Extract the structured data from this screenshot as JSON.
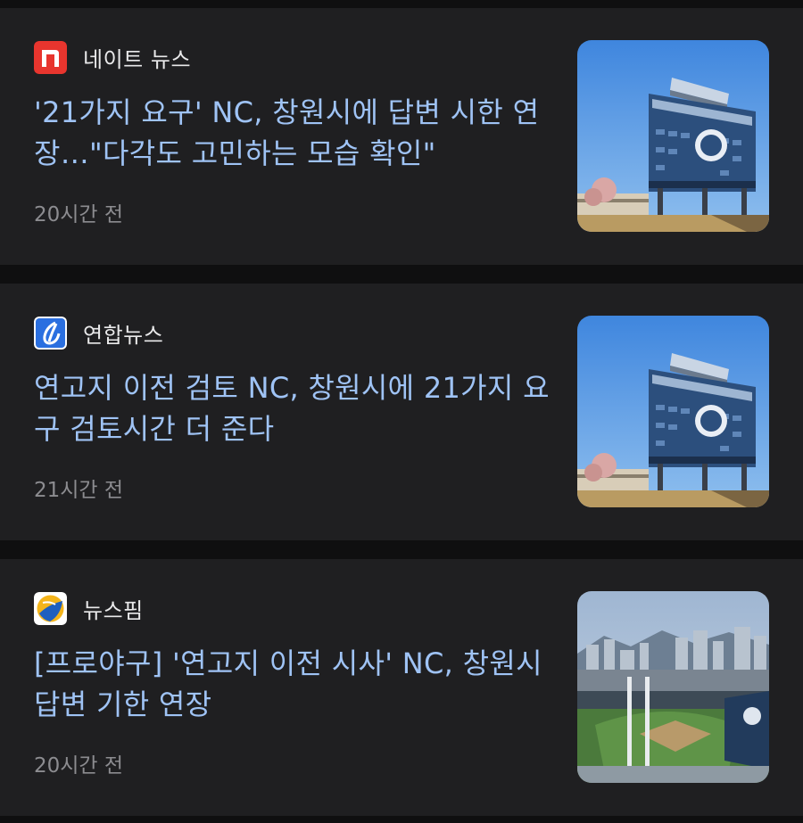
{
  "articles": [
    {
      "source": "네이트 뉴스",
      "source_icon": "nate-news-logo-icon",
      "headline": "'21가지 요구' NC, 창원시에 답변 시한 연장…\"다각도 고민하는 모습 확인\"",
      "time": "20시간 전",
      "thumbnail": "stadium-scoreboard-photo"
    },
    {
      "source": "연합뉴스",
      "source_icon": "yonhap-news-logo-icon",
      "headline": "연고지 이전 검토 NC, 창원시에 21가지 요구 검토시간 더 준다",
      "time": "21시간 전",
      "thumbnail": "stadium-scoreboard-photo"
    },
    {
      "source": "뉴스핌",
      "source_icon": "newspim-logo-icon",
      "headline": "[프로야구] '연고지 이전 시사' NC, 창원시 답변 기한 연장",
      "time": "20시간 전",
      "thumbnail": "stadium-aerial-photo"
    }
  ],
  "colors": {
    "background": "#0f0f10",
    "card": "#1f1f21",
    "headline": "#9fc3f5",
    "source": "#e9e9ea",
    "time": "#8c8c90",
    "nate_red": "#e8352e",
    "yonhap_blue": "#2a6fe0",
    "newspim_yellow": "#f4b41a",
    "newspim_blue": "#1e5fbf"
  }
}
